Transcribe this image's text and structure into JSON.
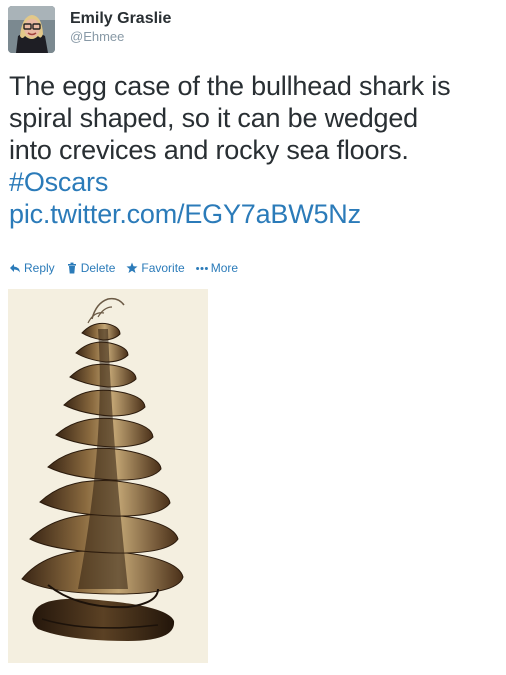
{
  "user": {
    "display_name": "Emily Graslie",
    "screen_name": "@Ehmee"
  },
  "tweet": {
    "text_line1": "The egg case of the bullhead shark is",
    "text_line2": "spiral shaped, so it can be wedged",
    "text_line3": "into crevices and rocky sea floors.",
    "hashtag": "#Oscars",
    "link": "pic.twitter.com/EGY7aBW5Nz"
  },
  "actions": {
    "reply": "Reply",
    "delete": "Delete",
    "favorite": "Favorite",
    "more": "More"
  },
  "icons": {
    "reply": "reply-icon",
    "delete": "trash-icon",
    "favorite": "star-icon",
    "more": "more-dots-icon"
  },
  "colors": {
    "link": "#2b7bb9",
    "text": "#292f33",
    "muted": "#8899a6"
  }
}
